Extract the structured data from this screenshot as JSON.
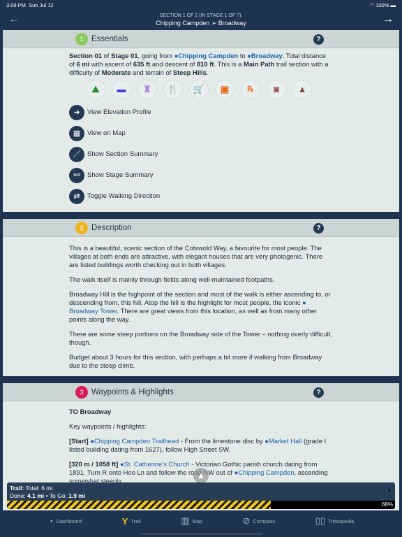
{
  "status": {
    "time": "3:09 PM",
    "date": "Sun Jul 12",
    "battery": "100%"
  },
  "nav": {
    "subtitle": "SECTION 1 OF 2 (IN STAGE 1 OF 7):",
    "title": "Chipping Campden ➢ Broadway",
    "back_icon": "arrow-left",
    "forward_icon": "arrow-right"
  },
  "essentials": {
    "number": "1",
    "title": "Essentials",
    "color": "#8dc95e",
    "summary": {
      "t1": "Section 01",
      "t2": " of ",
      "t3": "Stage 01",
      "t4": ", going from ",
      "from": "●Chipping Campden",
      "t5": " to ",
      "to": "●Broadway",
      "t6": ". Total distance of ",
      "dist": "6 mi",
      "t7": " with ascent of ",
      "asc": "635 ft",
      "t8": " and descent of ",
      "desc": "810 ft",
      "t9": ". This is a ",
      "type": "Main Path",
      "t10": " trail section with a difficulty of ",
      "diff": "Moderate",
      "t11": " and terrain of ",
      "terrain": "Steep Hills",
      "t12": "."
    },
    "amenities": [
      "trail-icon",
      "bed-icon",
      "castle-icon",
      "restaurant-icon",
      "shopping-cart-icon",
      "money-icon",
      "pharmacy-icon",
      "camera-icon",
      "mountain-icon"
    ],
    "actions": [
      "View Elevation Profile",
      "View on Map",
      "Show Section Summary",
      "Show Stage Summary",
      "Toggle Walking Direction"
    ]
  },
  "description": {
    "number": "2",
    "title": "Description",
    "color": "#f0b429",
    "p1": "This is a beautiful, scenic section of the Cotswold Way, a favourite for most people. The villages at both ends are attractive, with elegant houses that are very photogenic. There are listed buildings worth checking out in both villages.",
    "p2": "The walk itself is mainly through fields along well-maintained footpaths.",
    "p3a": "Broadway Hill is the highpoint of the section and most of the walk is either ascending to, or descending from, this hill. Atop the hill is the highlight for most people, the iconic ",
    "p3link": "● Broadway Tower",
    "p3b": ". There are great views from this location, as well as from many other points along the way.",
    "p4": "There are some steep portions on the Broadway side of the Tower – nothing overly difficult, though.",
    "p5": "Budget about 3 hours for this section, with perhaps a bit more if walking from Broadway due to the steep climb."
  },
  "waypoints": {
    "number": "3",
    "title": "Waypoints & Highlights",
    "color": "#d81b5a",
    "heading": "TO Broadway",
    "intro": "Key waypoints / highlights:",
    "w1": {
      "tag": "[Start]",
      "link": "●Chipping Campden Trailhead",
      "t1": " - From the limestone disc by ",
      "link2": "●Market Hall",
      "t2": " (grade I listed building dating from 1627), follow High Street SW."
    },
    "w2": {
      "tag": "[320 m / 1058 ft]",
      "link": "●St. Catherine's Church",
      "t1": " - Victorian Gothic parish church dating from 1891. Turn R onto Hoo Ln and follow the road NW out of ",
      "link2": "●Chipping Campden",
      "t2": ", ascending somewhat steeply."
    }
  },
  "trail": {
    "label": "Trail:",
    "total": " Total: 6 mi",
    "done_label": "Done: ",
    "done": "4.1 mi",
    "sep": " • To Go: ",
    "togo": "1.9 mi",
    "progress_pct": 68,
    "progress_text": "68%"
  },
  "tabs": [
    {
      "label": "Dashboard",
      "icon": "dashboard-icon"
    },
    {
      "label": "Trail",
      "icon": "trail-icon"
    },
    {
      "label": "Map",
      "icon": "map-icon"
    },
    {
      "label": "Compass",
      "icon": "compass-icon"
    },
    {
      "label": "Trekopedia",
      "icon": "book-icon"
    }
  ]
}
